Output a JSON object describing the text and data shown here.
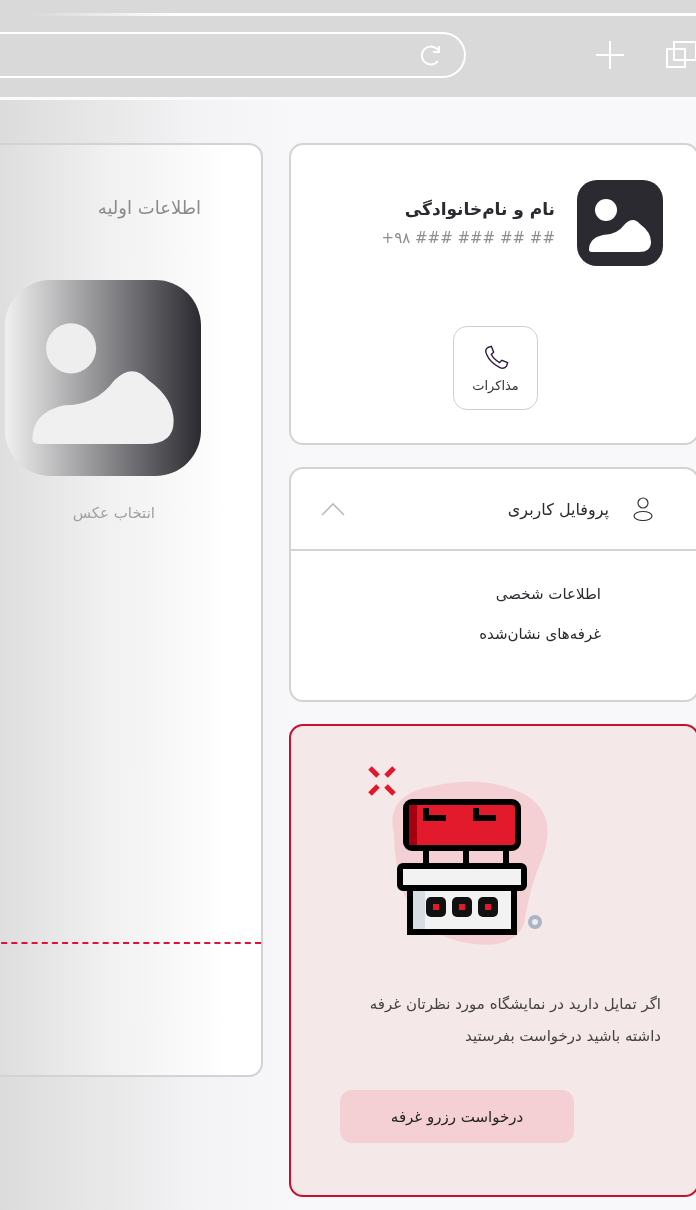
{
  "basic_info": {
    "title": "اطلاعات اولیه",
    "photo_label": "انتخاب عکس"
  },
  "contact_card": {
    "name": "نام و نام‌خانوادگی",
    "phone": "+۹۸ ### ### ## ##",
    "action": "مذاکرات"
  },
  "profile_menu": {
    "title": "پروفایل کاربری",
    "expanded": true,
    "items": [
      {
        "label": "اطلاعات شخصی"
      },
      {
        "label": "غرفه‌های نشان‌شده"
      }
    ]
  },
  "booth_promo": {
    "text": "اگر تمایل دارید در نمایشگاه مورد نظرتان غرفه داشته باشید درخواست بفرستید",
    "button": "درخواست رزرو غرفه"
  }
}
